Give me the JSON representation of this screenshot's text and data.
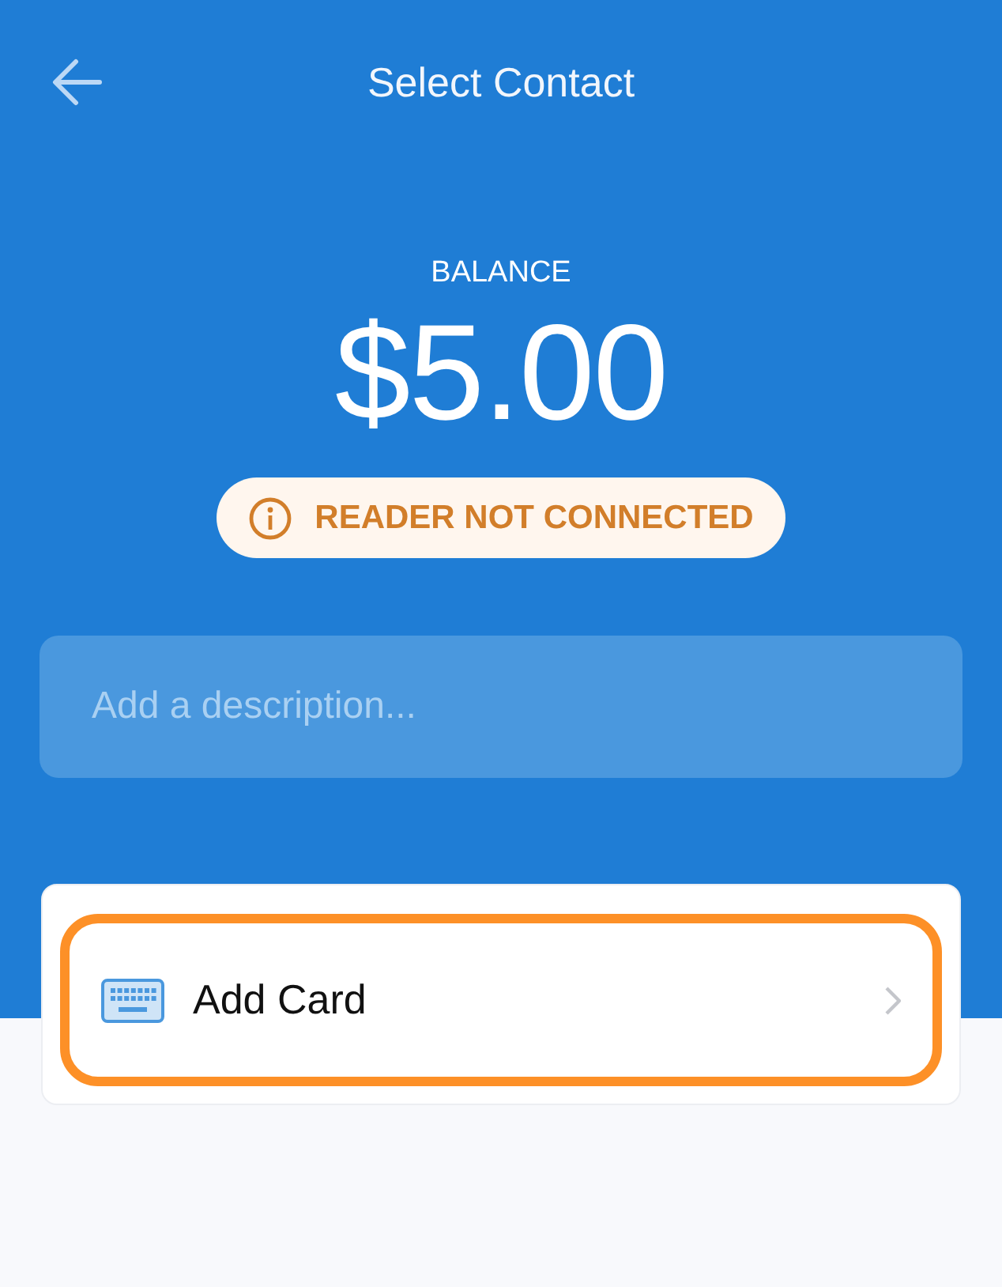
{
  "header": {
    "title": "Select Contact"
  },
  "balance": {
    "label": "BALANCE",
    "amount": "$5.00"
  },
  "reader_status": {
    "text": "READER NOT CONNECTED",
    "connected": false
  },
  "description_field": {
    "placeholder": "Add a description..."
  },
  "payment_options": [
    {
      "label": "Add Card",
      "highlighted": true
    }
  ]
}
